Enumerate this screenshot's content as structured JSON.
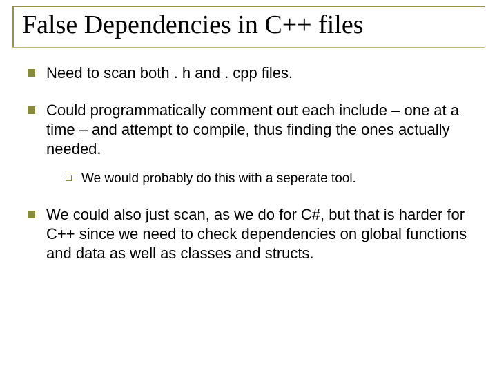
{
  "title": "False Dependencies in C++ files",
  "bullets": [
    {
      "text": "Need to scan both . h and . cpp files."
    },
    {
      "text": "Could programmatically comment out each include – one at a time – and attempt to compile, thus finding the ones actually needed.",
      "sub": [
        {
          "text": "We would probably do this with a seperate tool."
        }
      ]
    },
    {
      "text": "We could also just scan, as we do for C#, but that is harder for C++ since we need to check dependencies on global functions and data as well as classes and structs."
    }
  ]
}
